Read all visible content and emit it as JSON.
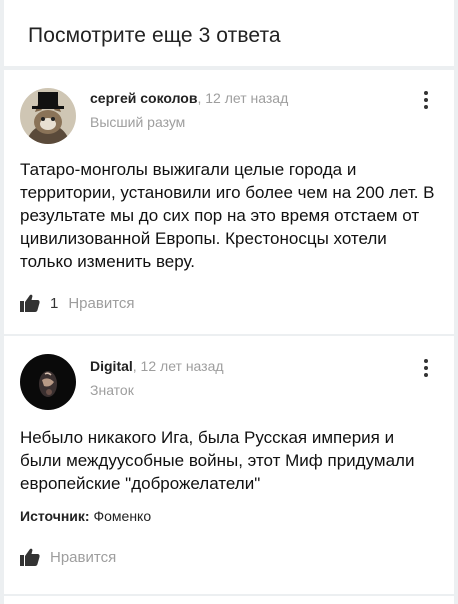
{
  "header": {
    "title": "Посмотрите еще 3 ответа"
  },
  "answers": [
    {
      "author": "сергей соколов",
      "time": ", 12 лет назад",
      "rank": "Высший разум",
      "avatar_icon": "cat-in-top-hat-icon",
      "text": "Татаро-монголы выжигали целые города и территории, установили иго более чем на 200 лет. В результате мы до сих пор на это время отстаем от цивилизованной Европы. Крестоносцы хотели только изменить веру.",
      "likes": "1",
      "like_label": "Нравится"
    },
    {
      "author": "Digital",
      "time": ", 12 лет назад",
      "rank": "Знаток",
      "avatar_icon": "dark-abstract-avatar-icon",
      "text": "Небыло никакого Ига, была Русская империя и были междуусобные войны, этот Миф придумали европейские \"доброжелатели\"",
      "source_label": "Источник:",
      "source_value": "Фоменко",
      "like_label": "Нравится"
    }
  ],
  "colors": {
    "muted": "#9e9e9e",
    "text": "#111111",
    "background": "#eceff1"
  }
}
